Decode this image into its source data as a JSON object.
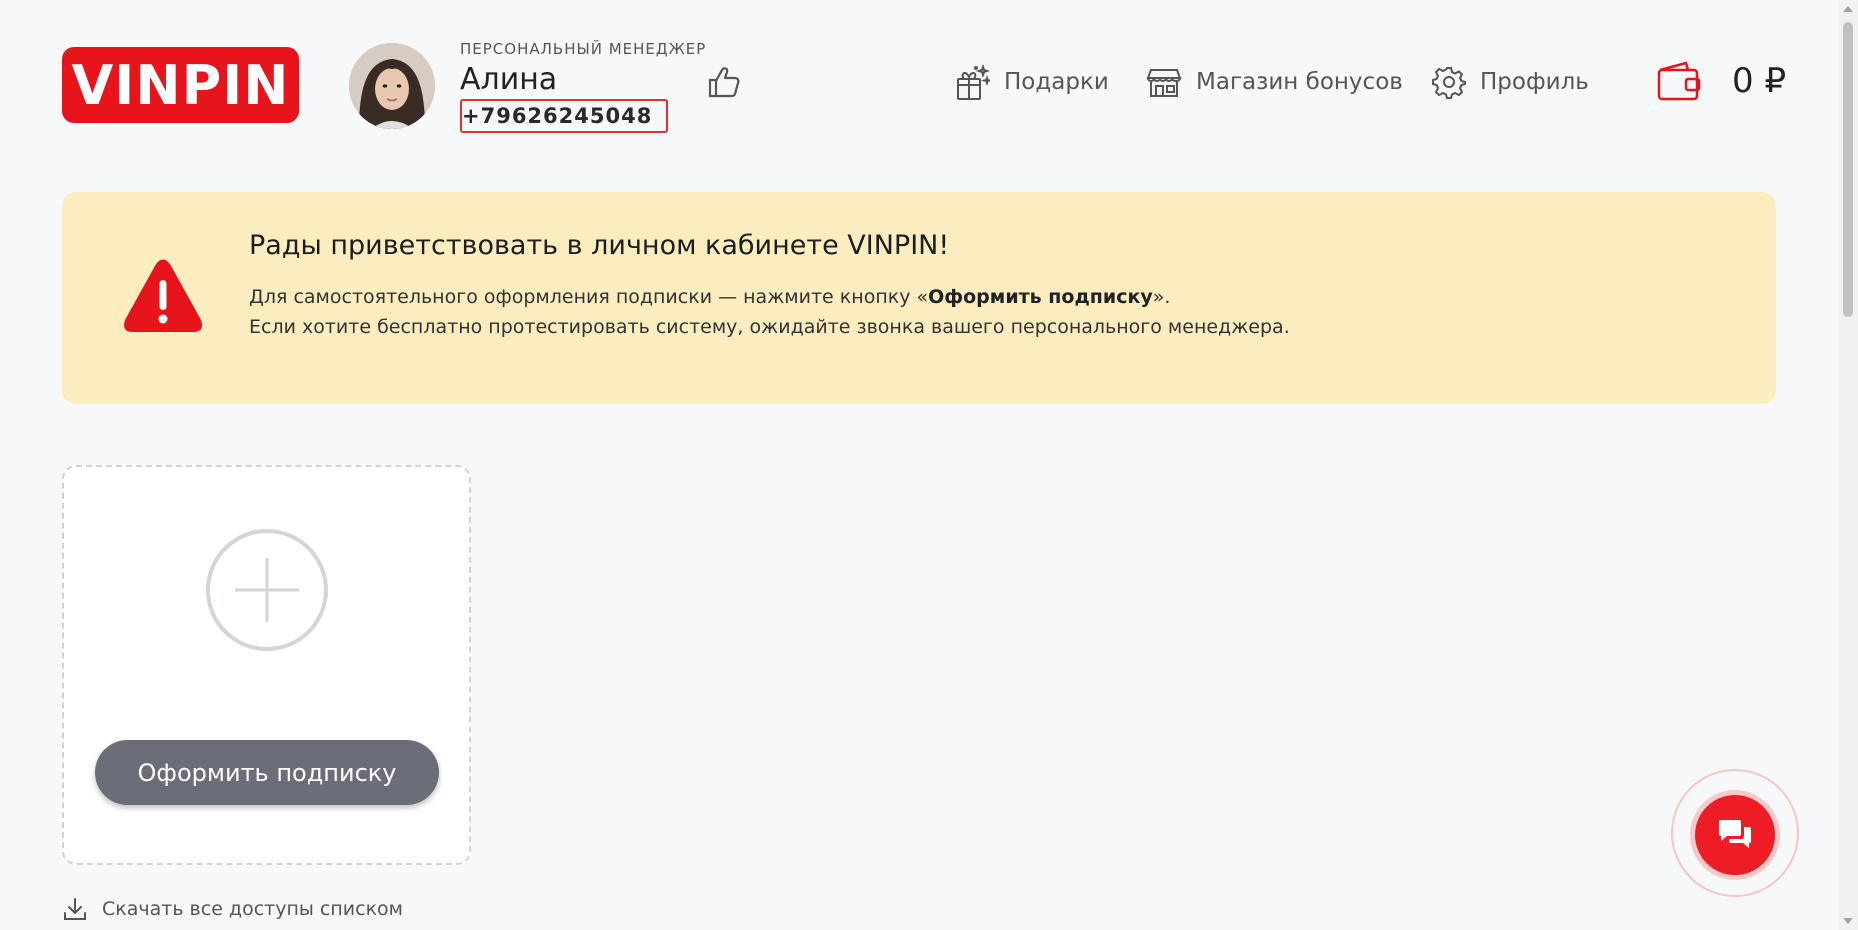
{
  "header": {
    "logo_text": "VINPIN",
    "manager": {
      "role": "Персональный менеджер",
      "name": "Алина",
      "phone": "+79626245048"
    },
    "nav": [
      {
        "label": "Подарки",
        "icon": "gift-icon"
      },
      {
        "label": "Магазин бонусов",
        "icon": "store-icon"
      },
      {
        "label": "Профиль",
        "icon": "gear-icon"
      }
    ],
    "wallet_amount": "0 ₽"
  },
  "banner": {
    "title": "Рады приветствовать в личном кабинете VINPIN!",
    "line1_prefix": "Для самостоятельного оформления подписки — нажмите кнопку «",
    "line1_bold": "Оформить подписку",
    "line1_suffix": "».",
    "line2": "Если хотите бесплатно протестировать систему, ожидайте звонка вашего персонального менеджера."
  },
  "card": {
    "button_label": "Оформить подписку"
  },
  "download_label": "Скачать все доступы списком",
  "colors": {
    "brand_red": "#e8141c",
    "banner_bg": "#fcedc1",
    "button_gray": "#6b6d78"
  }
}
